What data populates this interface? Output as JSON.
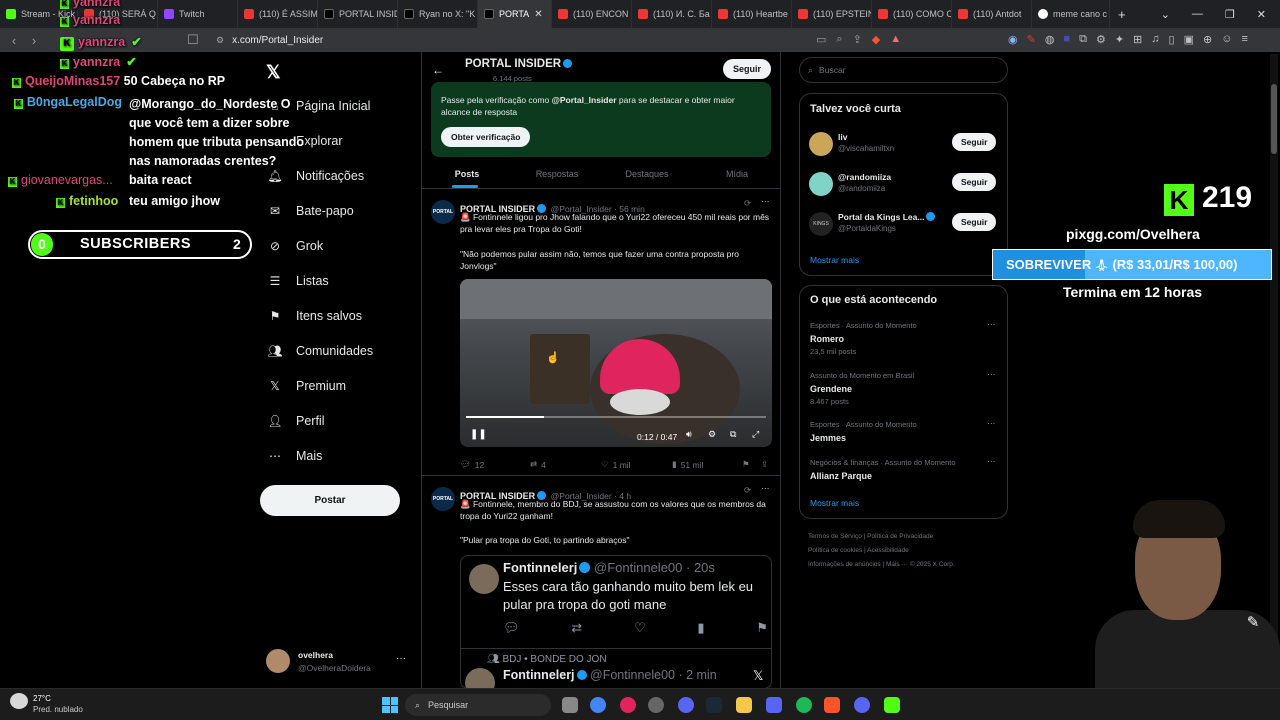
{
  "browser": {
    "tabs": [
      {
        "label": "Stream - Kick",
        "icon": "kick-icon"
      },
      {
        "label": "(110) SERÁ Q",
        "icon": "youtube-icon"
      },
      {
        "label": "Twitch",
        "icon": "twitch-icon"
      },
      {
        "label": "(110) É ASSIM",
        "icon": "youtube-icon"
      },
      {
        "label": "PORTAL INSIDE",
        "icon": "x-icon"
      },
      {
        "label": "Ryan no X: \"K",
        "icon": "x-icon"
      },
      {
        "label": "PORTA",
        "icon": "x-icon",
        "active": true
      },
      {
        "label": "(110) ENCON",
        "icon": "youtube-icon"
      },
      {
        "label": "(110) И. С. Ба",
        "icon": "youtube-icon"
      },
      {
        "label": "(110) Heartbe",
        "icon": "youtube-icon"
      },
      {
        "label": "(110) EPSTEIN",
        "icon": "youtube-icon"
      },
      {
        "label": "(110) COMO C",
        "icon": "youtube-icon"
      },
      {
        "label": "(110) Antdot",
        "icon": "youtube-icon"
      },
      {
        "label": "meme cano c",
        "icon": "google-icon"
      }
    ],
    "url": "x.com/Portal_Insider"
  },
  "x_nav": {
    "items": [
      {
        "label": "Página Inicial",
        "icon": "home-icon"
      },
      {
        "label": "Explorar",
        "icon": "search-icon"
      },
      {
        "label": "Notificações",
        "icon": "bell-icon"
      },
      {
        "label": "Bate-papo",
        "icon": "mail-icon"
      },
      {
        "label": "Grok",
        "icon": "grok-icon"
      },
      {
        "label": "Listas",
        "icon": "list-icon"
      },
      {
        "label": "Itens salvos",
        "icon": "bookmark-icon"
      },
      {
        "label": "Comunidades",
        "icon": "people-icon"
      },
      {
        "label": "Premium",
        "icon": "x-icon"
      },
      {
        "label": "Perfil",
        "icon": "person-icon"
      },
      {
        "label": "Mais",
        "icon": "more-icon"
      }
    ],
    "post_button": "Postar",
    "account": {
      "name": "ovelhera",
      "handle": "@OvelheraDoidera"
    }
  },
  "chat": {
    "messages": [
      {
        "user": "yannzra",
        "text": "",
        "color": "#e0457b"
      },
      {
        "user": "yannzra",
        "text": "",
        "color": "#e0457b"
      },
      {
        "user": "yannzra",
        "text": "",
        "color": "#e0457b"
      },
      {
        "user": "yannzra",
        "text": "",
        "color": "#e0457b"
      },
      {
        "user": "QueijoMinas157",
        "text": "50 Cabeça no RP",
        "color": "#e0457b"
      },
      {
        "user": "B0ngaLegalDog",
        "text": "@Morango_do_Nordeste O que você tem a dizer sobre homem que tributa pensando nas namoradas crentes?",
        "color": "#4ea8de"
      },
      {
        "user": "giovanevargas...",
        "text": "baita react",
        "color": "#e0457b"
      },
      {
        "user": "fetinhoo",
        "text": "teu amigo jhow",
        "color": "#a6e22e"
      }
    ],
    "sub_goal": {
      "current": "0",
      "label": "SUBSCRIBERS",
      "target": "2"
    }
  },
  "profile_header": {
    "name": "PORTAL INSIDER",
    "posts": "6.144 posts",
    "follow": "Seguir",
    "verify_text_pre": "Passe pela verificação como ",
    "verify_handle": "@Portal_Insider",
    "verify_text_post": " para se destacar e obter maior alcance de resposta",
    "verify_button": "Obter verificação",
    "tabs": [
      "Posts",
      "Respostas",
      "Destaques",
      "Mídia"
    ]
  },
  "tweet1": {
    "name": "PORTAL INSIDER",
    "handle": "@Portal_Insider",
    "time": "56 min",
    "text1": "🚨 Fontinnele ligou pro Jhow falando que o Yuri22 ofereceu 450 mil reais por mês pra levar eles pra Tropa do Goti!",
    "text2": "\"Não podemos pular assim não, temos que fazer uma contra proposta pro Jonvlogs\"",
    "video_time": "0:12 / 0:47",
    "progress": 0.26,
    "stats": {
      "replies": "12",
      "reposts": "4",
      "likes": "1 mil",
      "views": "51 mil"
    }
  },
  "tweet2": {
    "name": "PORTAL INSIDER",
    "handle": "@Portal_Insider",
    "time": "4 h",
    "text1": "🚨 Fontinnele, membro do BDJ, se assustou com os valores que os membros da tropa do Yuri22 ganham!",
    "text2": "\"Pular pra tropa do Goti, to partindo abraços\"",
    "quote": {
      "name": "Fontinnelerj",
      "handle": "@Fontinnele00",
      "time": "20s",
      "text": "Esses cara tão ganhando muito bem lek eu pular pra tropa do goti mane"
    },
    "quote2": {
      "context": "BDJ • BONDE DO JON",
      "name": "Fontinnelerj",
      "handle": "@Fontinnele00",
      "time": "2 min"
    }
  },
  "sidebar": {
    "search_placeholder": "Buscar",
    "who_to_follow": {
      "title": "Talvez você curta",
      "users": [
        {
          "name": "liv",
          "handle": "@viscahamiltxn"
        },
        {
          "name": "@randomiiza",
          "handle": "@randomiiza"
        },
        {
          "name": "Portal da Kings Lea...",
          "handle": "@PortaldaKings"
        }
      ],
      "button": "Seguir",
      "more": "Mostrar mais"
    },
    "trends": {
      "title": "O que está acontecendo",
      "items": [
        {
          "category": "Esportes · Assunto do Momento",
          "name": "Romero",
          "count": "23,5 mil posts"
        },
        {
          "category": "Assunto do Momento em Brasil",
          "name": "Grendene",
          "count": "8.467 posts"
        },
        {
          "category": "Esportes · Assunto do Momento",
          "name": "Jemmes",
          "count": ""
        },
        {
          "category": "Negócios & finanças · Assunto do Momento",
          "name": "Allianz Parque",
          "count": ""
        }
      ],
      "more": "Mostrar mais"
    },
    "footer": [
      "Termos de Serviço",
      "Política de Privacidade",
      "Política de cookies",
      "Acessibilidade",
      "Informações de anúncios",
      "Mais ···",
      "© 2025 X Corp."
    ]
  },
  "stream_overlay": {
    "kick_count": "219",
    "pix_url": "pixgg.com/Ovelhera",
    "goal_label": "SOBREVIVER",
    "goal_amount": "(R$ 33,01/R$ 100,00)",
    "goal_progress": 0.33,
    "ends": "Termina em 12 horas"
  },
  "taskbar": {
    "weather_temp": "27°C",
    "weather_desc": "Pred. nublado",
    "search_placeholder": "Pesquisar"
  }
}
